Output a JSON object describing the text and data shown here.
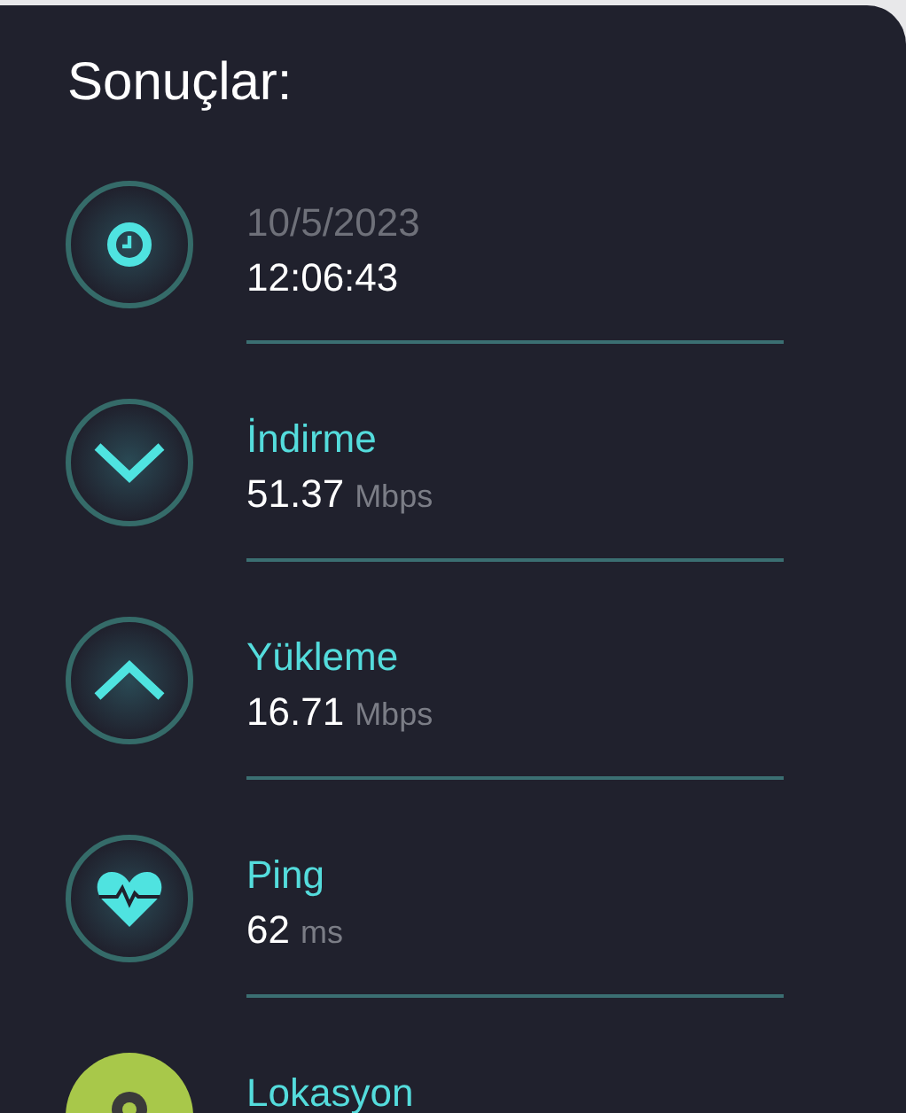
{
  "title": "Sonuçlar:",
  "results": [
    {
      "kind": "time",
      "date": "10/5/2023",
      "time": "12:06:43"
    },
    {
      "kind": "metric",
      "label": "İndirme",
      "value": "51.37",
      "unit": "Mbps"
    },
    {
      "kind": "metric",
      "label": "Yükleme",
      "value": "16.71",
      "unit": "Mbps"
    },
    {
      "kind": "metric",
      "label": "Ping",
      "value": "62",
      "unit": "ms"
    },
    {
      "kind": "label",
      "label": "Lokasyon"
    }
  ]
}
